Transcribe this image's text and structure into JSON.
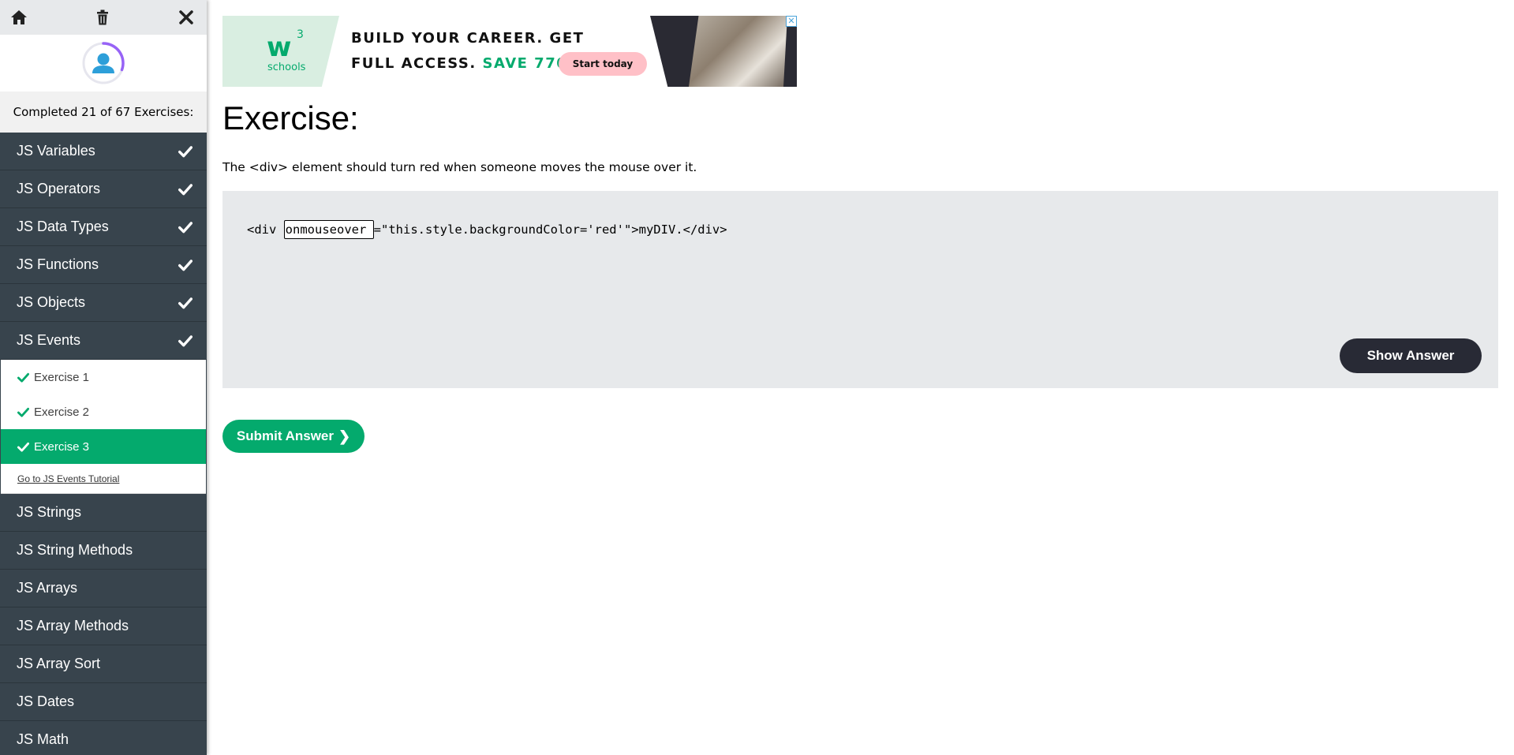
{
  "sidebar": {
    "progress_text": "Completed 21 of 67 Exercises:",
    "progress_fraction": 0.313,
    "accent_color": "#04aa6d",
    "icons": [
      "home-icon",
      "trash-icon",
      "close-icon",
      "user-icon"
    ],
    "categories_before": [
      {
        "label": "JS Variables",
        "completed": true
      },
      {
        "label": "JS Operators",
        "completed": true
      },
      {
        "label": "JS Data Types",
        "completed": true
      },
      {
        "label": "JS Functions",
        "completed": true
      },
      {
        "label": "JS Objects",
        "completed": true
      },
      {
        "label": "JS Events",
        "completed": true
      }
    ],
    "exercises": [
      {
        "label": "Exercise 1",
        "completed": true
      },
      {
        "label": "Exercise 2",
        "completed": true
      },
      {
        "label": "Exercise 3",
        "completed": true
      }
    ],
    "tutorial_link": "Go to JS Events Tutorial",
    "categories_after": [
      {
        "label": "JS Strings"
      },
      {
        "label": "JS String Methods"
      },
      {
        "label": "JS Arrays"
      },
      {
        "label": "JS Array Methods"
      },
      {
        "label": "JS Array Sort"
      },
      {
        "label": "JS Dates"
      },
      {
        "label": "JS Math"
      }
    ]
  },
  "ad": {
    "logo_letter": "w",
    "logo_super": "3",
    "logo_text": "schools",
    "line1": "BUILD YOUR CAREER. GET",
    "line2_prefix": "FULL ACCESS.",
    "line2_highlight": "SAVE 770$",
    "button": "Start today",
    "close": "✕"
  },
  "main": {
    "title": "Exercise:",
    "instruction": "The <div> element should turn red when someone moves the mouse over it.",
    "code_before": "<div ",
    "answer_value": "onmouseover",
    "code_after": "=\"this.style.backgroundColor='red'\">myDIV.</div>",
    "show_answer": "Show Answer",
    "submit": "Submit Answer",
    "submit_chevron": "❯"
  }
}
